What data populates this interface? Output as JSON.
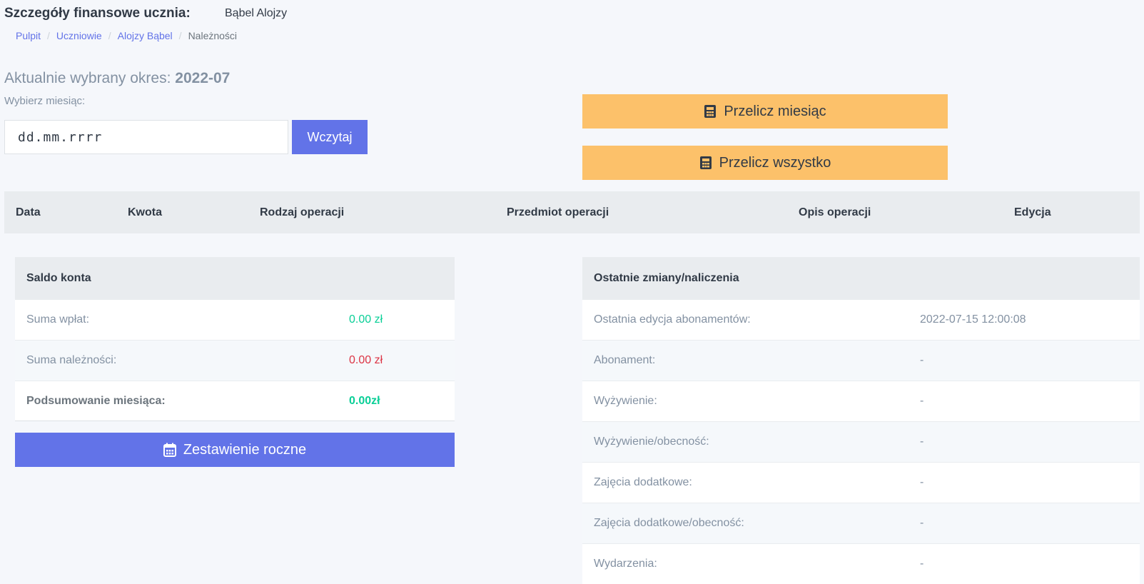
{
  "header": {
    "title": "Szczegóły finansowe ucznia:",
    "student_name": "Bąbel Alojzy"
  },
  "breadcrumb": {
    "items": [
      "Pulpit",
      "Uczniowie",
      "Alojzy Bąbel"
    ],
    "current": "Należności",
    "separator": "/"
  },
  "period": {
    "label": "Aktualnie wybrany okres:",
    "value": "2022-07"
  },
  "month_picker": {
    "label": "Wybierz miesiąc:",
    "placeholder": "dd.mm.rrrr",
    "load_button": "Wczytaj"
  },
  "actions": {
    "recalc_month": "Przelicz miesiąc",
    "recalc_all": "Przelicz wszystko",
    "icon": "calculator-icon"
  },
  "operations_table": {
    "columns": [
      "Data",
      "Kwota",
      "Rodzaj operacji",
      "Przedmiot operacji",
      "Opis operacji",
      "Edycja"
    ],
    "rows": []
  },
  "balance": {
    "title": "Saldo konta",
    "rows": [
      {
        "label": "Suma wpłat:",
        "value": "0.00 zł"
      },
      {
        "label": "Suma należności:",
        "value": "0.00 zł"
      },
      {
        "label": "Podsumowanie miesiąca:",
        "value": "0.00zł"
      }
    ],
    "year_button": "Zestawienie roczne",
    "year_icon": "calendar-icon"
  },
  "recent_changes": {
    "title": "Ostatnie zmiany/naliczenia",
    "rows": [
      {
        "label": "Ostatnia edycja abonamentów:",
        "value": "2022-07-15 12:00:08"
      },
      {
        "label": "Abonament:",
        "value": "-"
      },
      {
        "label": "Wyżywienie:",
        "value": "-"
      },
      {
        "label": "Wyżywienie/obecność:",
        "value": "-"
      },
      {
        "label": "Zajęcia dodatkowe:",
        "value": "-"
      },
      {
        "label": "Zajęcia dodatkowe/obecność:",
        "value": "-"
      },
      {
        "label": "Wydarzenia:",
        "value": "-"
      }
    ]
  },
  "colors": {
    "primary": "#6273e8",
    "warning": "#fcc16a",
    "positive": "#0acf97",
    "negative": "#dc3545"
  }
}
